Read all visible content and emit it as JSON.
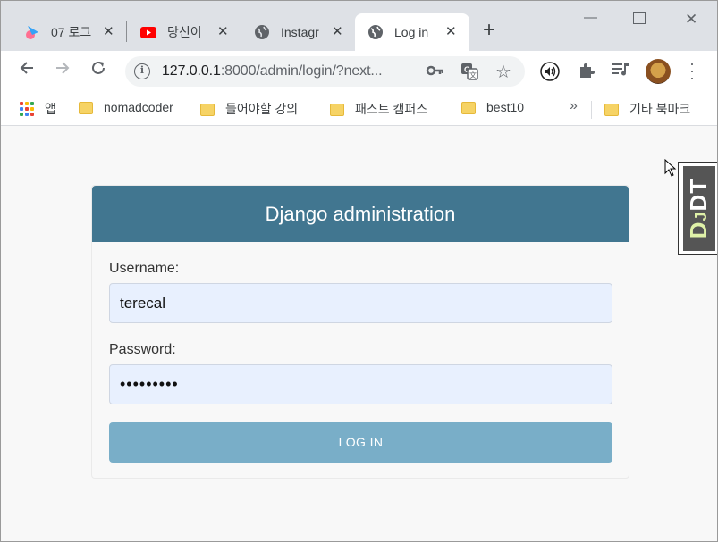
{
  "browser": {
    "tabs": [
      {
        "title": "07 로그",
        "favicon": "app-icon"
      },
      {
        "title": "당신이",
        "favicon": "youtube-icon"
      },
      {
        "title": "Instagr",
        "favicon": "globe-icon"
      },
      {
        "title": "Log in",
        "favicon": "globe-icon"
      }
    ],
    "url_host": "127.0.0.1",
    "url_rest": ":8000/admin/login/?next...",
    "bookmarks": [
      {
        "label": "앱",
        "icon": "apps-grid-icon"
      },
      {
        "label": "nomadcoder",
        "icon": "folder-icon"
      },
      {
        "label": "들어야할 강의",
        "icon": "folder-icon"
      },
      {
        "label": "패스트 캠퍼스",
        "icon": "folder-icon"
      },
      {
        "label": "best10",
        "icon": "folder-icon"
      }
    ],
    "bookmarks_more": "»",
    "other_bookmarks": "기타 북마크"
  },
  "login": {
    "header": "Django administration",
    "username_label": "Username:",
    "username_value": "terecal",
    "password_label": "Password:",
    "password_value": "•••••••••",
    "submit_label": "LOG IN"
  },
  "debug_toolbar": {
    "label_dj": "D",
    "label_j": "J",
    "label_dt": "DT"
  },
  "colors": {
    "header_bg": "#417690",
    "button_bg": "#79aec8",
    "input_bg": "#e8f0fe"
  }
}
